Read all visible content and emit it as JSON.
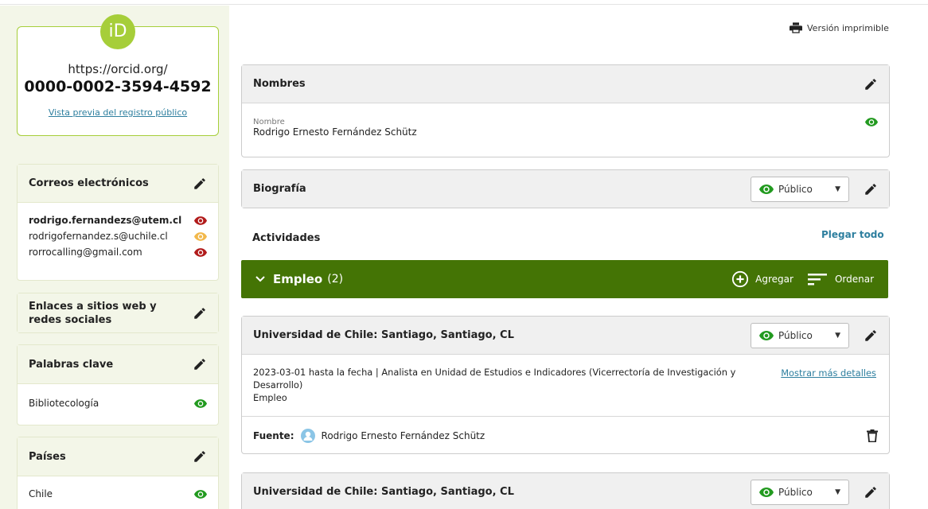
{
  "sidebar": {
    "orcid_logo": "iD",
    "orcid_url": "https://orcid.org/",
    "orcid_id": "0000-0002-3594-4592",
    "preview_link": "Vista previa del registro público",
    "emails": {
      "title": "Correos electrónicos",
      "items": [
        {
          "address": "rodrigo.fernandezs@utem.cl",
          "visibility": "private",
          "color": "#b11b1b"
        },
        {
          "address": "rodrigofernandez.s@uchile.cl",
          "visibility": "trusted",
          "color": "#f2b84b"
        },
        {
          "address": "rorrocalling@gmail.com",
          "visibility": "private",
          "color": "#b11b1b"
        }
      ]
    },
    "websites": {
      "title_line1": "Enlaces a sitios web y",
      "title_line2": "redes sociales"
    },
    "keywords": {
      "title": "Palabras clave",
      "items": [
        {
          "text": "Bibliotecología",
          "color": "#229a1f"
        }
      ]
    },
    "countries": {
      "title": "Países",
      "items": [
        {
          "text": "Chile",
          "color": "#229a1f"
        }
      ]
    }
  },
  "toolbar": {
    "printable_label": "Versión imprimible"
  },
  "names": {
    "title": "Nombres",
    "field_label": "Nombre",
    "field_value": "Rodrigo Ernesto Fernández Schütz",
    "visibility_color": "#229a1f"
  },
  "biography": {
    "title": "Biografía",
    "visibility_label": "Público"
  },
  "activities": {
    "title": "Actividades",
    "fold_all": "Plegar todo"
  },
  "employment": {
    "title": "Empleo",
    "count": "(2)",
    "add_label": "Agregar",
    "sort_label": "Ordenar",
    "bar_color": "#447405",
    "items": [
      {
        "org": "Universidad de Chile: Santiago, Santiago, CL",
        "visibility_label": "Público",
        "line1": "2023-03-01 hasta la fecha | Analista en Unidad de Estudios e Indicadores (Vicerrectoría de Investigación y",
        "line2": "Desarrollo)",
        "type": "Empleo",
        "more_link": "Mostrar más detalles",
        "source_label": "Fuente",
        "source_name": "Rodrigo Ernesto Fernández Schütz"
      },
      {
        "org": "Universidad de Chile: Santiago, Santiago, CL",
        "visibility_label": "Público"
      }
    ]
  }
}
